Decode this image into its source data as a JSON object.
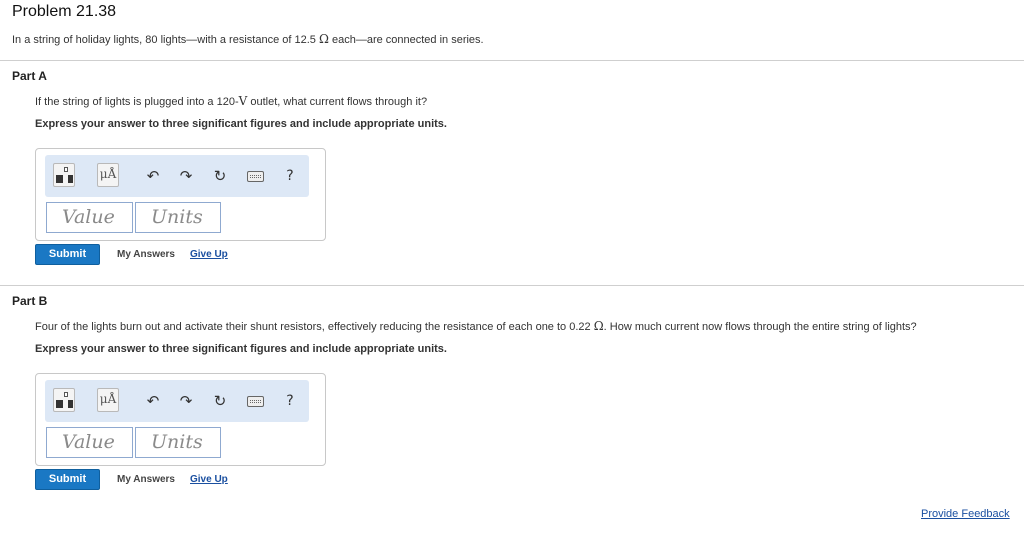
{
  "problem": {
    "title": "Problem 21.38",
    "intro_before": "In a string of holiday lights, 80 lights—with a resistance of 12.5",
    "intro_unit": "Ω",
    "intro_after": "each—are connected in series."
  },
  "toolbar_icons": [
    "templates-icon",
    "units-icon",
    "undo-icon",
    "redo-icon",
    "reset-icon",
    "keyboard-icon",
    "help-icon"
  ],
  "parts": [
    {
      "title": "Part A",
      "question_before": "If the string of lights is plugged into a 120-",
      "question_unit": "V",
      "question_after": "outlet, what current flows through it?",
      "instruction": "Express your answer to three significant figures and include appropriate units.",
      "units_button": "μÅ",
      "help": "?",
      "value_placeholder": "Value",
      "units_placeholder": "Units",
      "submit": "Submit",
      "my_answers": "My Answers",
      "give_up": "Give Up"
    },
    {
      "title": "Part B",
      "question_before": "Four of the lights burn out and activate their shunt resistors, effectively reducing the resistance of each one to 0.22",
      "question_unit": "Ω",
      "question_after": ". How much current now flows through the entire string of lights?",
      "instruction": "Express your answer to three significant figures and include appropriate units.",
      "units_button": "μÅ",
      "help": "?",
      "value_placeholder": "Value",
      "units_placeholder": "Units",
      "submit": "Submit",
      "my_answers": "My Answers",
      "give_up": "Give Up"
    }
  ],
  "footer": {
    "feedback_link": "Provide Feedback"
  }
}
